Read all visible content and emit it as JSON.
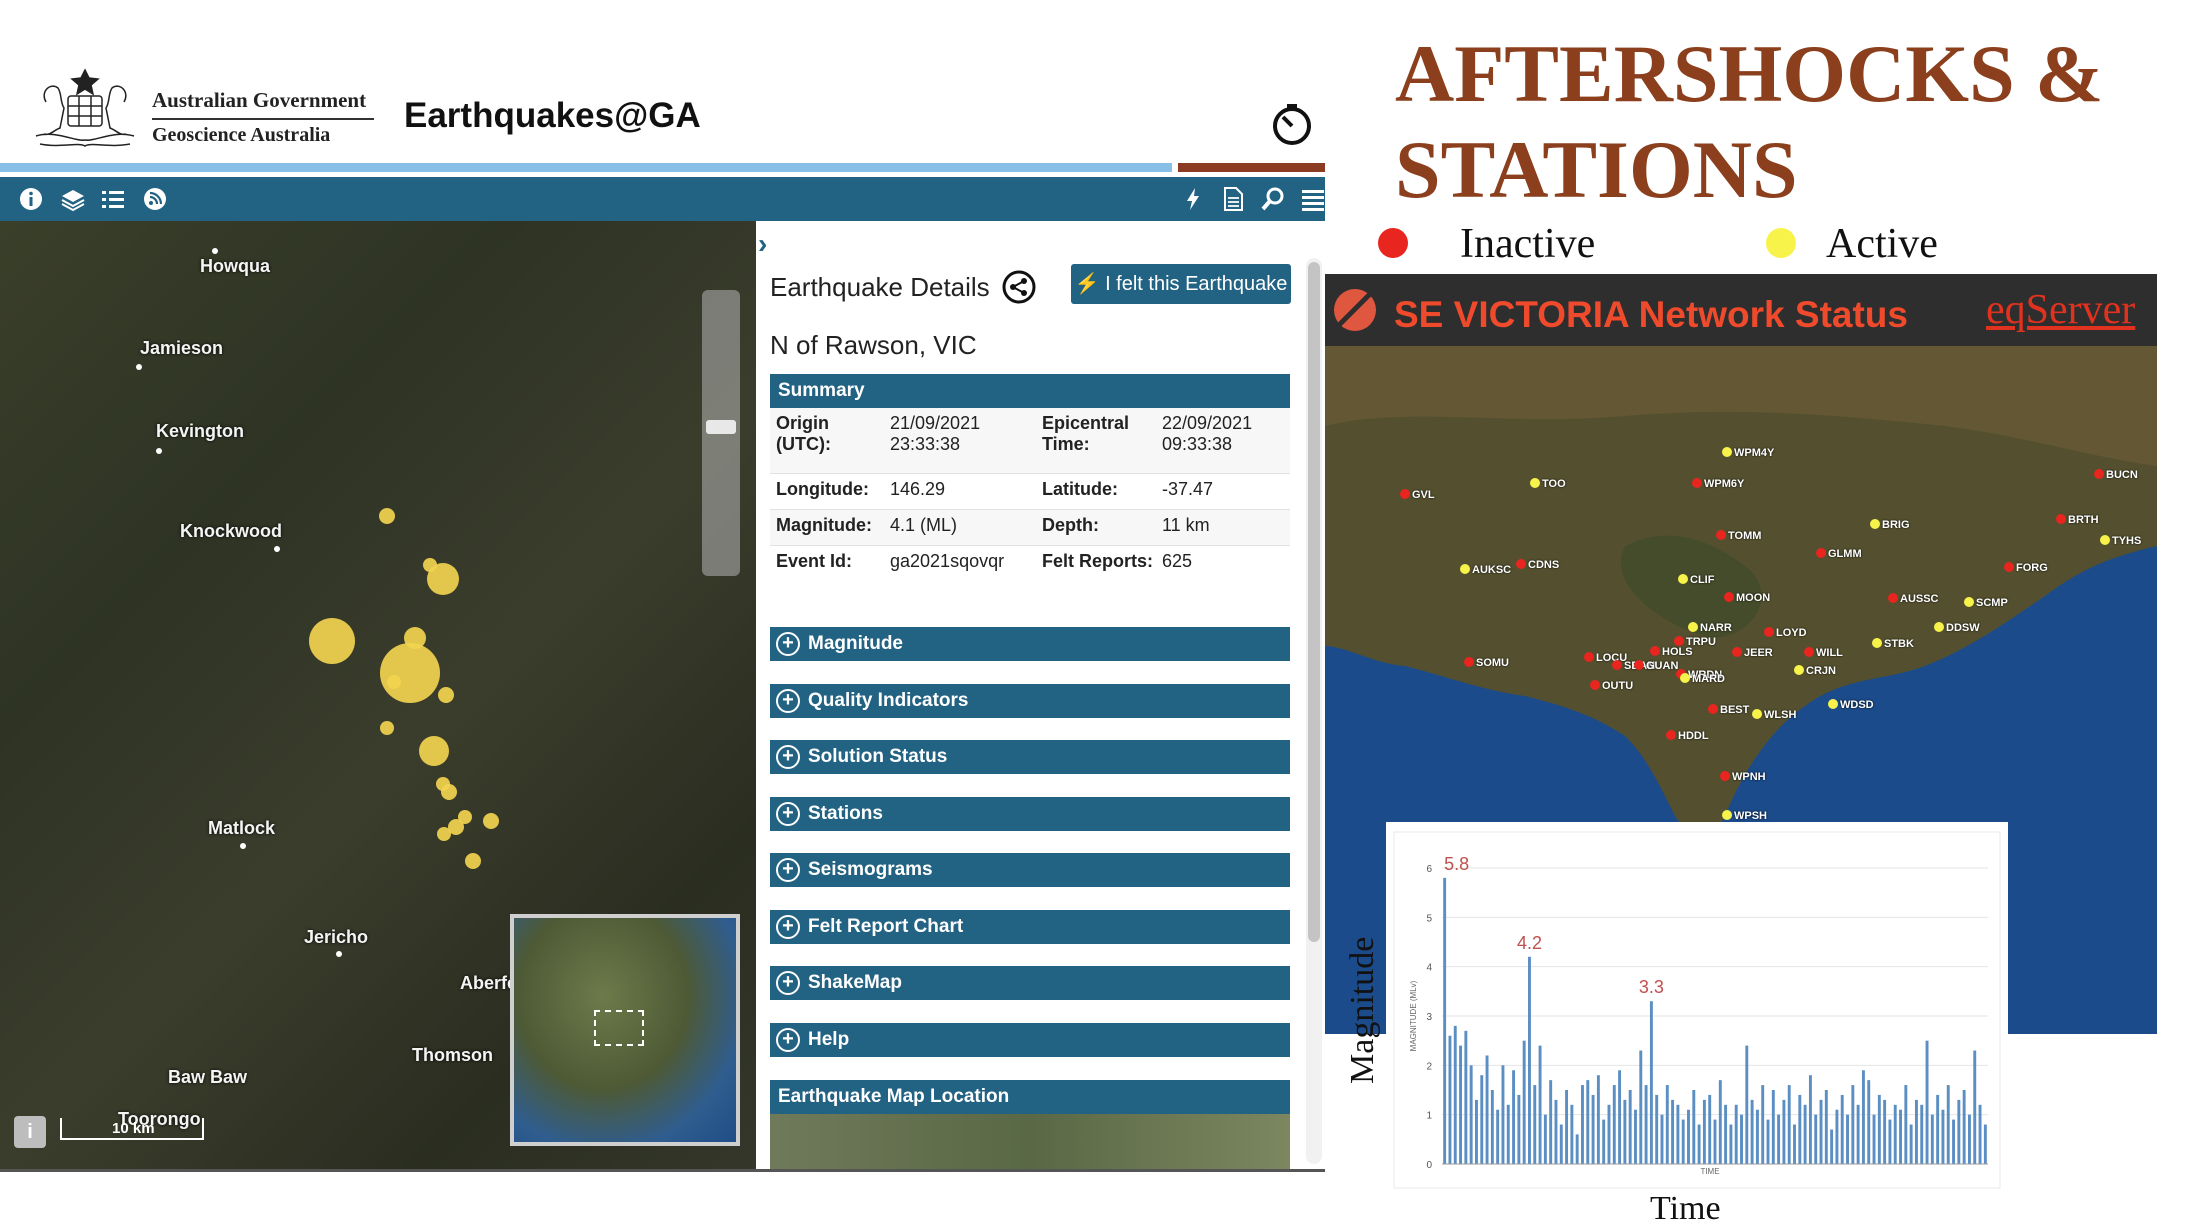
{
  "header": {
    "gov_line1": "Australian Government",
    "gov_line2": "Geoscience Australia",
    "app_title": "Earthquakes@GA"
  },
  "toolbar": {
    "left_icons": [
      "info-icon",
      "layers-icon",
      "list-icon",
      "rss-icon"
    ],
    "right_icons": [
      "lightning-icon",
      "document-icon",
      "search-icon",
      "menu-icon"
    ]
  },
  "map": {
    "towns": [
      "Howqua",
      "Jamieson",
      "Kevington",
      "Knockwood",
      "Matlock",
      "Jericho",
      "Aberfe",
      "Thomson",
      "Baw Baw",
      "Toorongo"
    ],
    "scale_label": "10 km",
    "info_label": "i"
  },
  "details": {
    "title": "Earthquake Details",
    "felt_button": "I felt this Earthquake",
    "event_name": "N of Rawson, VIC",
    "summary_header": "Summary",
    "rows": [
      {
        "l1": "Origin (UTC):",
        "v1": "21/09/2021 23:33:38",
        "l2": "Epicentral Time:",
        "v2": "22/09/2021 09:33:38"
      },
      {
        "l1": "Longitude:",
        "v1": "146.29",
        "l2": "Latitude:",
        "v2": "-37.47"
      },
      {
        "l1": "Magnitude:",
        "v1": "4.1 (ML)",
        "l2": "Depth:",
        "v2": "11 km"
      },
      {
        "l1": "Event Id:",
        "v1": "ga2021sqovqr",
        "l2": "Felt Reports:",
        "v2": "625"
      }
    ],
    "sections": [
      "Magnitude",
      "Quality Indicators",
      "Solution Status",
      "Stations",
      "Seismograms",
      "Felt Report Chart",
      "ShakeMap",
      "Help"
    ],
    "location_header": "Earthquake Map Location"
  },
  "slide": {
    "heading_line1": "AFTERSHOCKS &",
    "heading_line2": "STATIONS",
    "legend_inactive": "Inactive",
    "legend_active": "Active",
    "colors": {
      "inactive": "#e8251f",
      "active": "#f7f34a",
      "heading": "#8b3f1c"
    }
  },
  "network": {
    "title": "SE VICTORIA Network Status",
    "link": "eqServer",
    "stations": [
      {
        "name": "WPM4Y",
        "active": true
      },
      {
        "name": "TOO",
        "active": true
      },
      {
        "name": "WPM6Y",
        "active": false
      },
      {
        "name": "GVL",
        "active": false
      },
      {
        "name": "BUCN",
        "active": false
      },
      {
        "name": "BRIG",
        "active": true
      },
      {
        "name": "BRTH",
        "active": false
      },
      {
        "name": "TYHS",
        "active": true
      },
      {
        "name": "TOMM",
        "active": false
      },
      {
        "name": "GLMM",
        "active": false
      },
      {
        "name": "AUKSC",
        "active": true
      },
      {
        "name": "CDNS",
        "active": false
      },
      {
        "name": "CLIF",
        "active": true
      },
      {
        "name": "FORG",
        "active": false
      },
      {
        "name": "MOON",
        "active": false
      },
      {
        "name": "AUSSC",
        "active": false
      },
      {
        "name": "SCMP",
        "active": true
      },
      {
        "name": "NARR",
        "active": true
      },
      {
        "name": "LOYD",
        "active": false
      },
      {
        "name": "TRPU",
        "active": false
      },
      {
        "name": "DDSW",
        "active": true
      },
      {
        "name": "HOLS",
        "active": false
      },
      {
        "name": "JEER",
        "active": false
      },
      {
        "name": "WILL",
        "active": false
      },
      {
        "name": "STBK",
        "active": true
      },
      {
        "name": "LOCU",
        "active": false
      },
      {
        "name": "SBAN",
        "active": false
      },
      {
        "name": "GUAN",
        "active": false
      },
      {
        "name": "CRJN",
        "active": true
      },
      {
        "name": "SOMU",
        "active": false
      },
      {
        "name": "WRDN",
        "active": false
      },
      {
        "name": "MARD",
        "active": true
      },
      {
        "name": "OUTU",
        "active": false
      },
      {
        "name": "BEST",
        "active": false
      },
      {
        "name": "WLSH",
        "active": true
      },
      {
        "name": "WDSD",
        "active": true
      },
      {
        "name": "HDDL",
        "active": false
      },
      {
        "name": "WPNH",
        "active": false
      },
      {
        "name": "WPSH",
        "active": true
      }
    ]
  },
  "chart_data": {
    "type": "bar",
    "ylabel": "Magnitude",
    "xlabel": "Time",
    "inner_ylabel": "MAGNITUDE (MLv)",
    "inner_xlabel": "TIME",
    "ylim": [
      0,
      6
    ],
    "yticks": [
      0,
      1,
      2,
      3,
      4,
      5,
      6
    ],
    "annotations": [
      "5.8",
      "4.2",
      "3.3"
    ],
    "values": [
      5.8,
      2.6,
      2.8,
      2.4,
      2.7,
      2.0,
      1.3,
      1.8,
      2.2,
      1.5,
      1.1,
      2.0,
      1.2,
      1.9,
      1.4,
      2.5,
      4.2,
      1.6,
      2.4,
      1.0,
      1.7,
      1.3,
      0.8,
      1.5,
      1.2,
      0.6,
      1.6,
      1.7,
      1.4,
      1.8,
      0.9,
      1.2,
      1.6,
      1.9,
      1.3,
      1.5,
      1.1,
      2.3,
      1.6,
      3.3,
      1.4,
      1.0,
      1.6,
      1.3,
      1.2,
      0.9,
      1.1,
      1.5,
      0.8,
      1.3,
      1.4,
      0.9,
      1.7,
      1.2,
      0.8,
      1.2,
      1.0,
      2.4,
      1.3,
      1.1,
      1.6,
      0.9,
      1.5,
      1.0,
      1.3,
      1.6,
      0.8,
      1.4,
      1.2,
      1.8,
      1.0,
      1.3,
      1.5,
      0.7,
      1.1,
      1.4,
      1.0,
      1.6,
      1.2,
      1.9,
      1.7,
      1.0,
      1.4,
      1.3,
      0.9,
      1.2,
      1.1,
      1.6,
      0.8,
      1.3,
      1.2,
      2.5,
      1.0,
      1.4,
      1.1,
      1.6,
      0.9,
      1.3,
      1.5,
      1.0,
      2.3,
      1.2,
      0.8
    ]
  }
}
